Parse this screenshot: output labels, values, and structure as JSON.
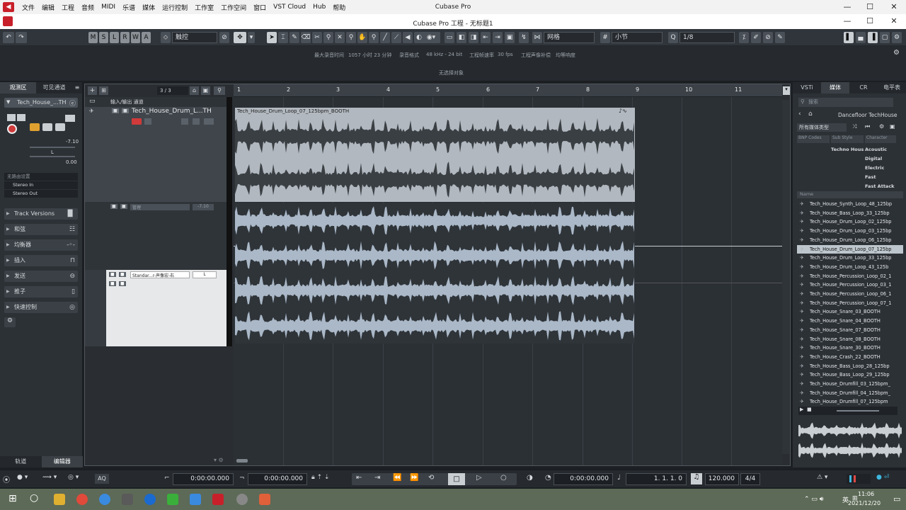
{
  "menubar": {
    "items": [
      "文件",
      "编辑",
      "工程",
      "音频",
      "MIDI",
      "乐谱",
      "媒体",
      "运行控制",
      "工作室",
      "工作空间",
      "窗口",
      "VST Cloud",
      "Hub",
      "帮助"
    ],
    "app_title": "Cubase Pro",
    "min": "—",
    "max": "☐",
    "close": "✕"
  },
  "window": {
    "title": "Cubase Pro 工程 - 无标题1"
  },
  "toolbar": {
    "modes": [
      "M",
      "S",
      "L",
      "R",
      "W",
      "A"
    ],
    "automation_mode": "触控",
    "snap_type": "网格",
    "grid": "小节",
    "quantize": "1/8"
  },
  "info": {
    "max_rec_time_label": "最大录音时间",
    "max_rec_time": "1057 小时 23 分钟",
    "rec_format_label": "录音格式",
    "rec_format": "48 kHz - 24 bit",
    "frame_rate_label": "工程帧速率",
    "frame_rate": "30 fps",
    "pan_label": "工程声像补偿",
    "pan": "均等响度"
  },
  "status": {
    "text": "无选择对象"
  },
  "inspector": {
    "tabs": [
      "观测区",
      "可见通道"
    ],
    "track_name": "Tech_House_...TH",
    "volume": "-7.10",
    "pan": "L",
    "value2": "0.00",
    "routing": [
      "无路由设置",
      "Stereo In",
      "Stereo Out"
    ],
    "sections": [
      "Track Versions",
      "和弦",
      "均衡器",
      "插入",
      "发送",
      "推子",
      "快速控制"
    ],
    "bottom_tabs": [
      "轨道",
      "编辑器"
    ]
  },
  "project": {
    "counter": "3 / 3",
    "folder_label": "输入/输出 通道",
    "tracks": [
      {
        "name": "Tech_House_Drum_L...TH"
      },
      {
        "name": "管理",
        "value": "-7.10"
      },
      {
        "name": "Standar...r-声像宏-右",
        "value": "L"
      }
    ],
    "ruler": [
      "1",
      "2",
      "3",
      "4",
      "5",
      "6",
      "7",
      "8",
      "9",
      "10",
      "11"
    ],
    "event_name": "Tech_House_Drum_Loop_07_125bpm_BOOTH"
  },
  "mediabay": {
    "tabs": [
      "VSTi",
      "媒体",
      "CR",
      "电平表"
    ],
    "search_placeholder": "搜索",
    "path": "Dancefloor TechHouse",
    "filter": "所有媒体类型",
    "attrs": [
      "BNP Codes",
      "Sub Style",
      "Character"
    ],
    "attr_values": [
      "Techno Hous",
      "Acoustic",
      "Digital",
      "Electric",
      "Fast",
      "Fast Attack"
    ],
    "col_name": "Name",
    "files": [
      "Tech_House_Synth_Loop_48_125bp",
      "Tech_House_Bass_Loop_33_125bp",
      "Tech_House_Drum_Loop_02_125bp",
      "Tech_House_Drum_Loop_03_125bp",
      "Tech_House_Drum_Loop_06_125bp",
      "Tech_House_Drum_Loop_07_125bp",
      "Tech_House_Drum_Loop_33_125bp",
      "Tech_House_Drum_Loop_43_125b",
      "Tech_House_Percussion_Loop_02_1",
      "Tech_House_Percussion_Loop_03_1",
      "Tech_House_Percussion_Loop_06_1",
      "Tech_House_Percussion_Loop_07_1",
      "Tech_House_Snare_03_BOOTH",
      "Tech_House_Snare_04_BOOTH",
      "Tech_House_Snare_07_BOOTH",
      "Tech_House_Snare_08_BOOTH",
      "Tech_House_Snare_30_BOOTH",
      "Tech_House_Crash_22_BOOTH",
      "Tech_House_Bass_Loop_28_125bp",
      "Tech_House_Bass_Loop_29_125bp",
      "Tech_House_Drumfill_03_125bpm_",
      "Tech_House_Drumfill_04_125bpm_",
      "Tech_House_Drumfill_07_125bpm"
    ],
    "selected_index": 5
  },
  "transport": {
    "left_locator": "0:00:00.000",
    "right_locator": "0:00:00.000",
    "position_time": "0:00:00.000",
    "position_bars": "1. 1. 1.   0",
    "tempo": "120.000",
    "signature": "4/4",
    "aq": "AQ"
  },
  "taskbar": {
    "time": "11:06",
    "date": "2021/12/20",
    "ime": "英"
  }
}
